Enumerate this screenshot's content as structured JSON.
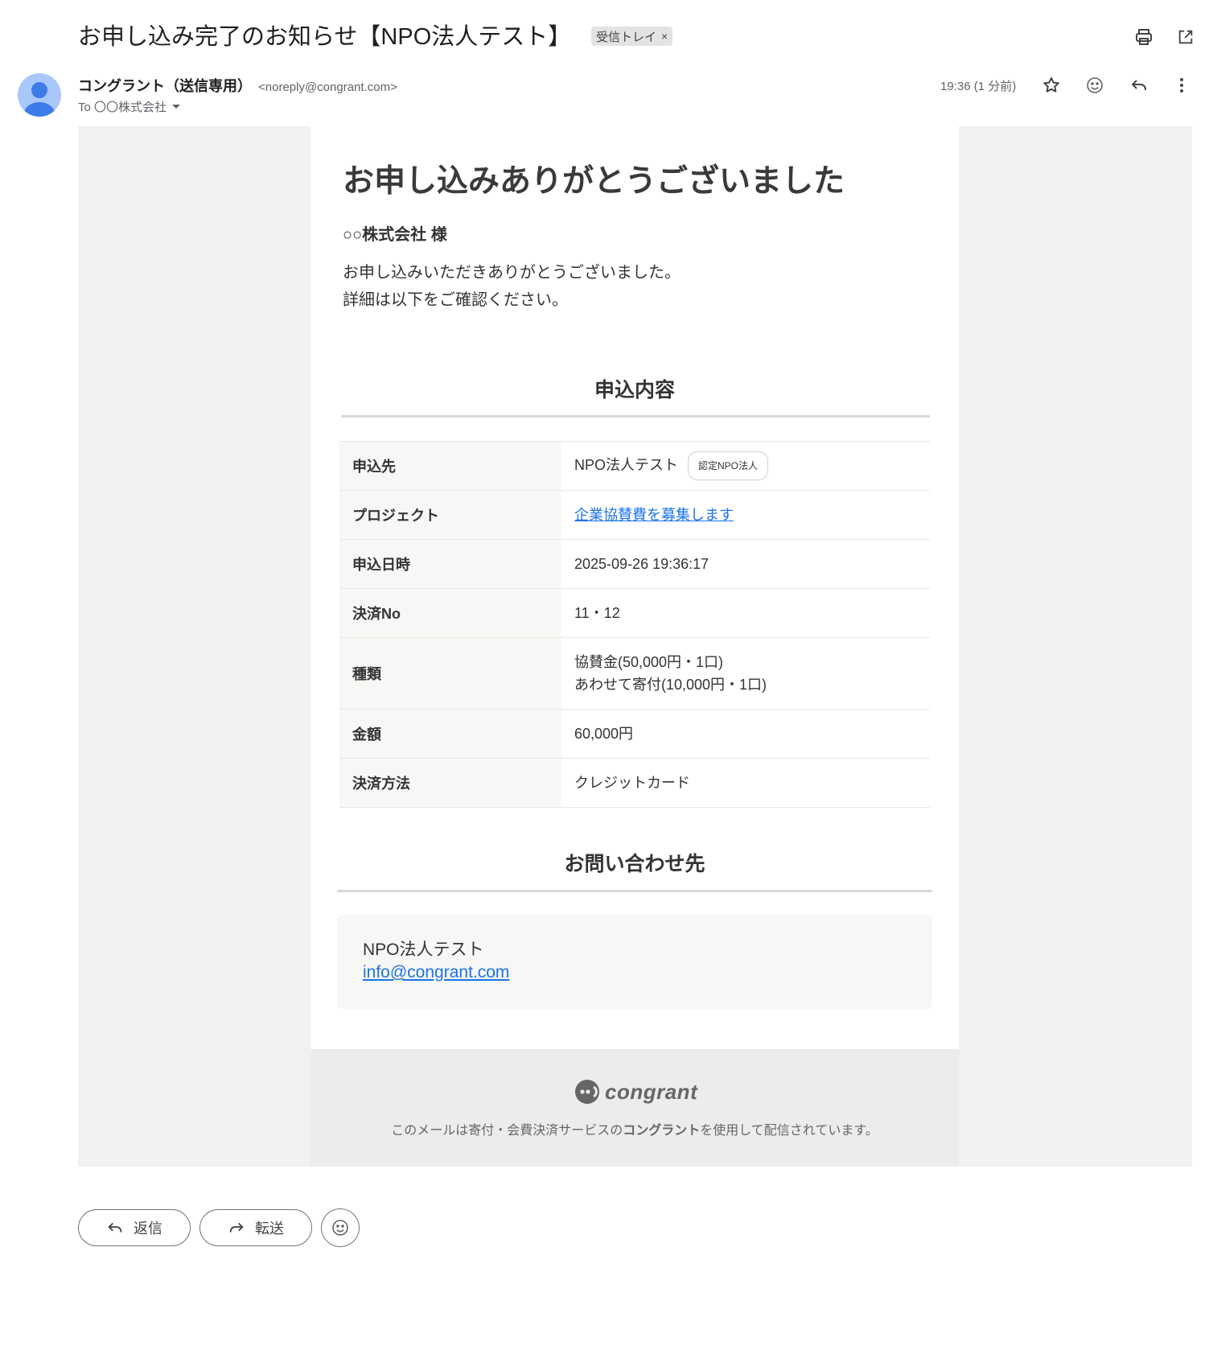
{
  "header": {
    "subject": "お申し込み完了のお知らせ【NPO法人テスト】",
    "label": "受信トレイ",
    "label_remove": "×"
  },
  "sender": {
    "name": "コングラント（送信専用）",
    "email": "<noreply@congrant.com>",
    "to": "To 〇〇株式会社",
    "time": "19:36 (1 分前)"
  },
  "body": {
    "heading": "お申し込みありがとうございました",
    "salutation": "○○株式会社 様",
    "line1": "お申し込みいただきありがとうございました。",
    "line2": "詳細は以下をご確認ください。",
    "section_details": "申込内容",
    "rows": {
      "dest_label": "申込先",
      "dest_value": "NPO法人テスト",
      "dest_badge": "認定NPO法人",
      "project_label": "プロジェクト",
      "project_value": "企業協賛費を募集します",
      "date_label": "申込日時",
      "date_value": "2025-09-26 19:36:17",
      "payno_label": "決済No",
      "payno_value": "11・12",
      "type_label": "種類",
      "type_line1": "協賛金(50,000円・1口)",
      "type_line2": "あわせて寄付(10,000円・1口)",
      "amount_label": "金額",
      "amount_value": "60,000円",
      "method_label": "決済方法",
      "method_value": "クレジットカード"
    },
    "section_contact": "お問い合わせ先",
    "contact_name": "NPO法人テスト",
    "contact_email": "info@congrant.com"
  },
  "footer": {
    "logo_text": "congrant",
    "text_before": "このメールは寄付・会費決済サービスの",
    "text_bold": "コングラント",
    "text_after": "を使用して配信されています。"
  },
  "actions": {
    "reply": "返信",
    "forward": "転送"
  },
  "colors": {
    "link": "#1a73e8",
    "avatar": "#a8c7fa",
    "avatar_figure": "#3c7be8"
  }
}
